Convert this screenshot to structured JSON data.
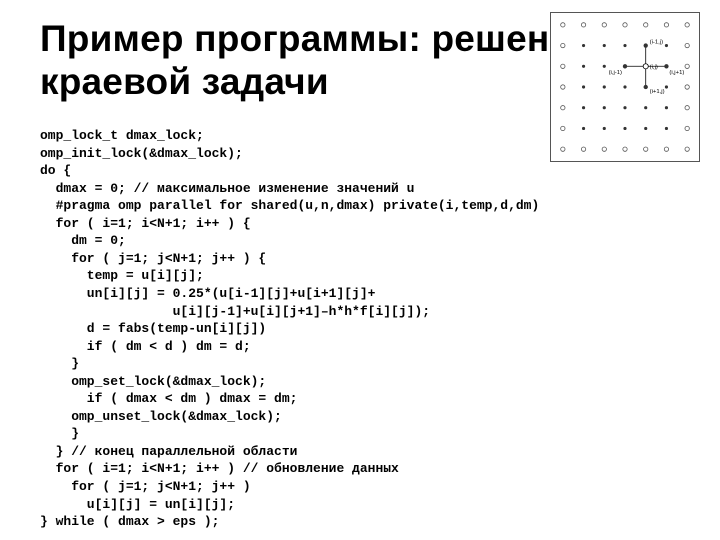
{
  "title": "Пример программы: решение краевой задачи",
  "code_lines": [
    "omp_lock_t dmax_lock;",
    "omp_init_lock(&dmax_lock);",
    "do {",
    "  dmax = 0; // максимальное изменение значений u",
    "  #pragma omp parallel for shared(u,n,dmax) private(i,temp,d,dm)",
    "  for ( i=1; i<N+1; i++ ) {",
    "    dm = 0;",
    "    for ( j=1; j<N+1; j++ ) {",
    "      temp = u[i][j];",
    "      un[i][j] = 0.25*(u[i-1][j]+u[i+1][j]+",
    "                 u[i][j-1]+u[i][j+1]–h*h*f[i][j]);",
    "      d = fabs(temp-un[i][j])",
    "      if ( dm < d ) dm = d;",
    "    }",
    "    omp_set_lock(&dmax_lock);",
    "      if ( dmax < dm ) dmax = dm;",
    "    omp_unset_lock(&dmax_lock);",
    "    }",
    "  } // конец параллельной области",
    "  for ( i=1; i<N+1; i++ ) // обновление данных",
    "    for ( j=1; j<N+1; j++ )",
    "      u[i][j] = un[i][j];",
    "} while ( dmax > eps );"
  ],
  "diagram": {
    "grid_rows": 7,
    "grid_cols": 7,
    "stencil_labels": {
      "center": "(i,j)",
      "up": "(i-1,j)",
      "down": "(i+1,j)",
      "left": "(i,j-1)",
      "right": "(i,j+1)"
    }
  }
}
